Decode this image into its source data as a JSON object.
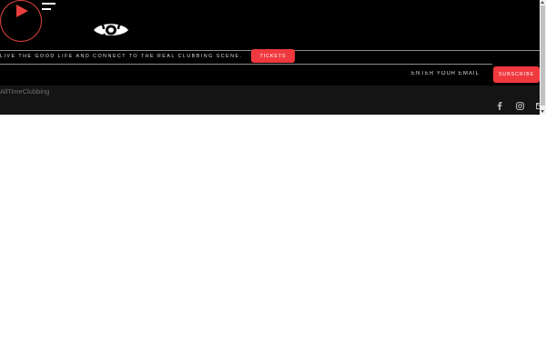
{
  "header": {
    "tagline": "LIVE THE GOOD LIFE AND CONNECT TO THE REAL CLUBBING SCENE.",
    "tickets_label": "TICKETS",
    "email_placeholder": "ENTER YOUR EMAIL",
    "subscribe_label": "SUBSCRIBE"
  },
  "footer": {
    "brand": "AllTimeClubbing",
    "social_icons": [
      "facebook-icon",
      "instagram-icon",
      "email-icon"
    ]
  },
  "icons": {
    "player": "play-icon",
    "menu": "hamburger-menu-icon",
    "logo": "eye-logo-icon"
  },
  "colors": {
    "background": "#000000",
    "accent": "#f0393e",
    "footer_background": "#141414",
    "text": "#ffffff"
  }
}
